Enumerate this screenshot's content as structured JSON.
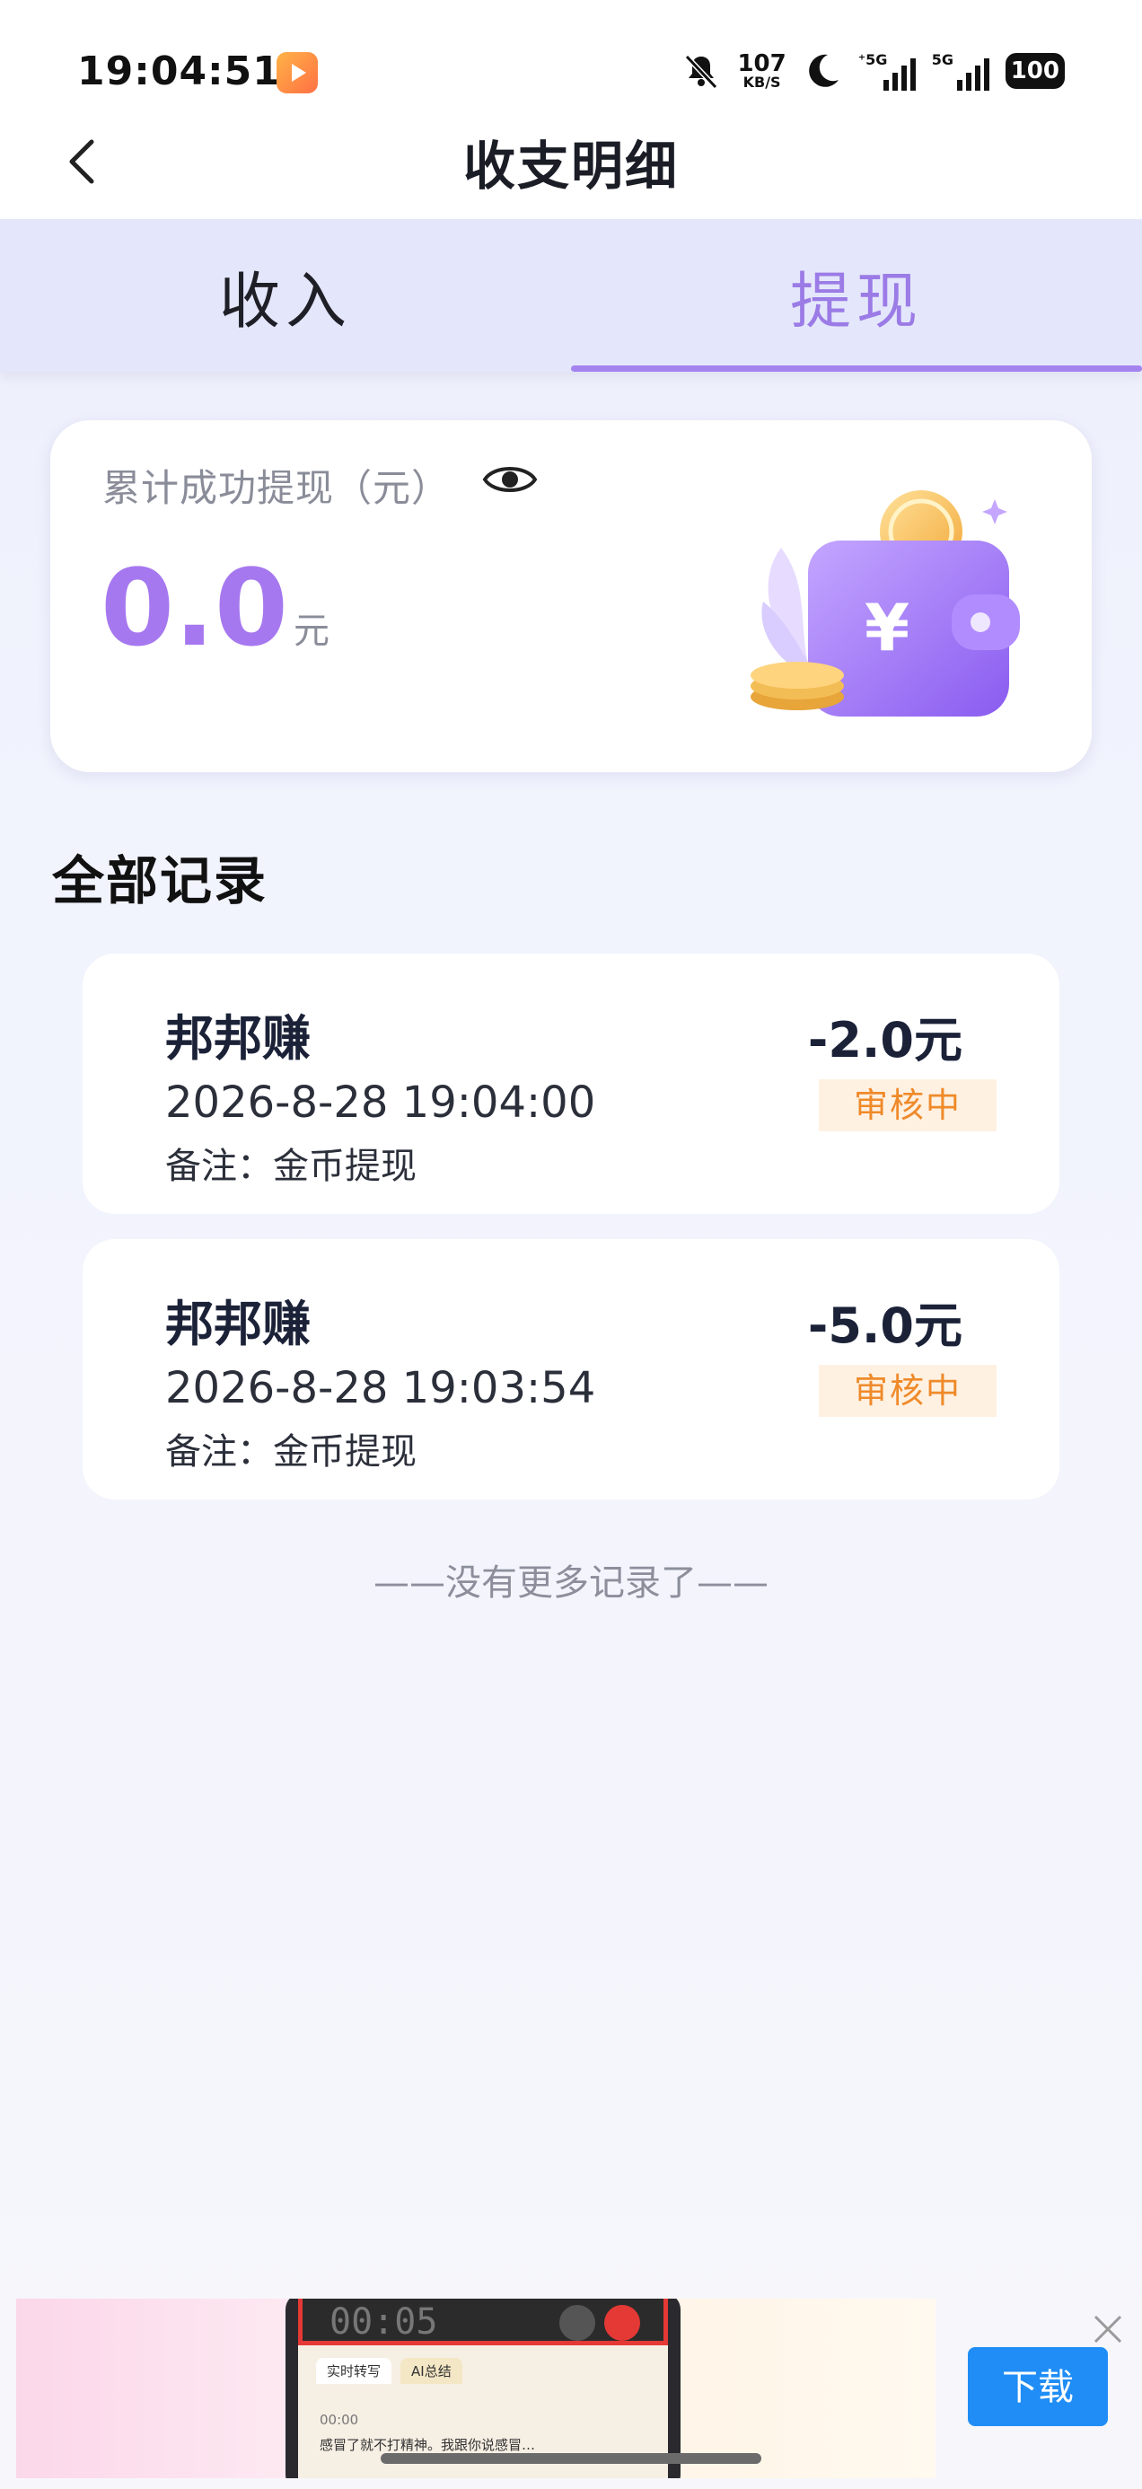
{
  "status_bar": {
    "time": "19:04:51",
    "net_speed_value": "107",
    "net_speed_unit": "KB/S",
    "signal_1_tag": "⁺5G",
    "signal_2_tag": "5G",
    "battery": "100",
    "icons": [
      "app-badge-icon",
      "mute-bell-icon",
      "moon-icon",
      "signal-icon",
      "battery-icon"
    ]
  },
  "nav": {
    "title": "收支明细",
    "back_icon": "chevron-left-icon"
  },
  "tabs": [
    {
      "label": "收入",
      "active": false
    },
    {
      "label": "提现",
      "active": true
    }
  ],
  "summary": {
    "label": "累计成功提现（元）",
    "amount": "0.0",
    "unit": "元",
    "eye_icon": "eye-icon",
    "accent_color": "#a678ef"
  },
  "records": {
    "title": "全部记录",
    "items": [
      {
        "name": "邦邦赚",
        "time": "2026-8-28 19:04:00",
        "note": "备注：金币提现",
        "amount": "-2.0元",
        "status": "审核中"
      },
      {
        "name": "邦邦赚",
        "time": "2026-8-28 19:03:54",
        "note": "备注：金币提现",
        "amount": "-5.0元",
        "status": "审核中"
      }
    ],
    "no_more": "——没有更多记录了——",
    "status_color": "#ef8a2a"
  },
  "ad": {
    "rec_time": "00:05",
    "tab_1": "实时转写",
    "tab_2": "AI总结",
    "line_1": "00:00",
    "line_2": "感冒了就不打精神。我跟你说感冒…",
    "download_label": "下载",
    "close_icon": "close-icon",
    "download_color": "#1f8df5"
  }
}
